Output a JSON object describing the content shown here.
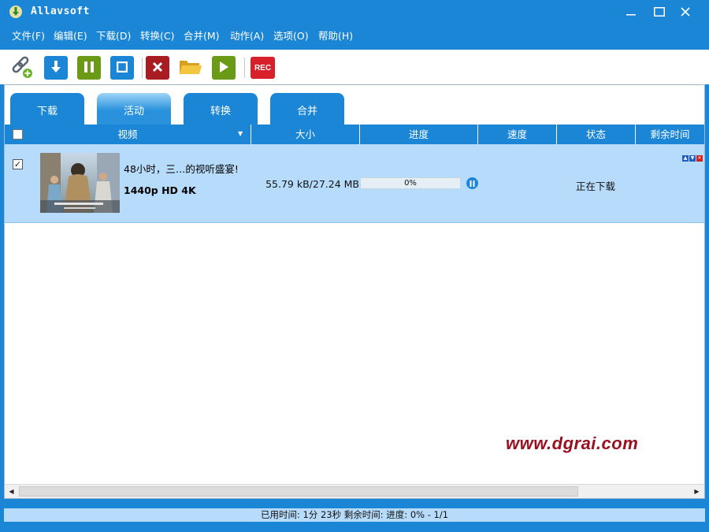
{
  "window": {
    "title": "Allavsoft"
  },
  "menu": [
    "文件(F)",
    "编辑(E)",
    "下载(D)",
    "转换(C)",
    "合并(M)",
    "动作(A)",
    "选项(O)",
    "帮助(H)"
  ],
  "toolbar": {
    "rec_label": "REC"
  },
  "tabs": [
    {
      "label": "下载",
      "active": false
    },
    {
      "label": "活动",
      "active": true
    },
    {
      "label": "转换",
      "active": false
    },
    {
      "label": "合并",
      "active": false
    }
  ],
  "columns": [
    "视频",
    "大小",
    "进度",
    "速度",
    "状态",
    "剩余时间"
  ],
  "rows": [
    {
      "checked": "✓",
      "title": "48小时，三…的视听盛宴!",
      "quality": "1440p HD 4K",
      "size": "55.79 kB/27.24 MB",
      "progress_text": "0%",
      "progress": 0,
      "status": "正在下载"
    }
  ],
  "watermark": "www.dgrai.com",
  "statusbar": "已用时间: 1分 23秒 剩余时间: 进度: 0% - 1/1",
  "colors": {
    "accent": "#1c86d6",
    "row_selected": "#b7dcfb",
    "rec": "#d8202a",
    "watermark": "#9b1020"
  }
}
